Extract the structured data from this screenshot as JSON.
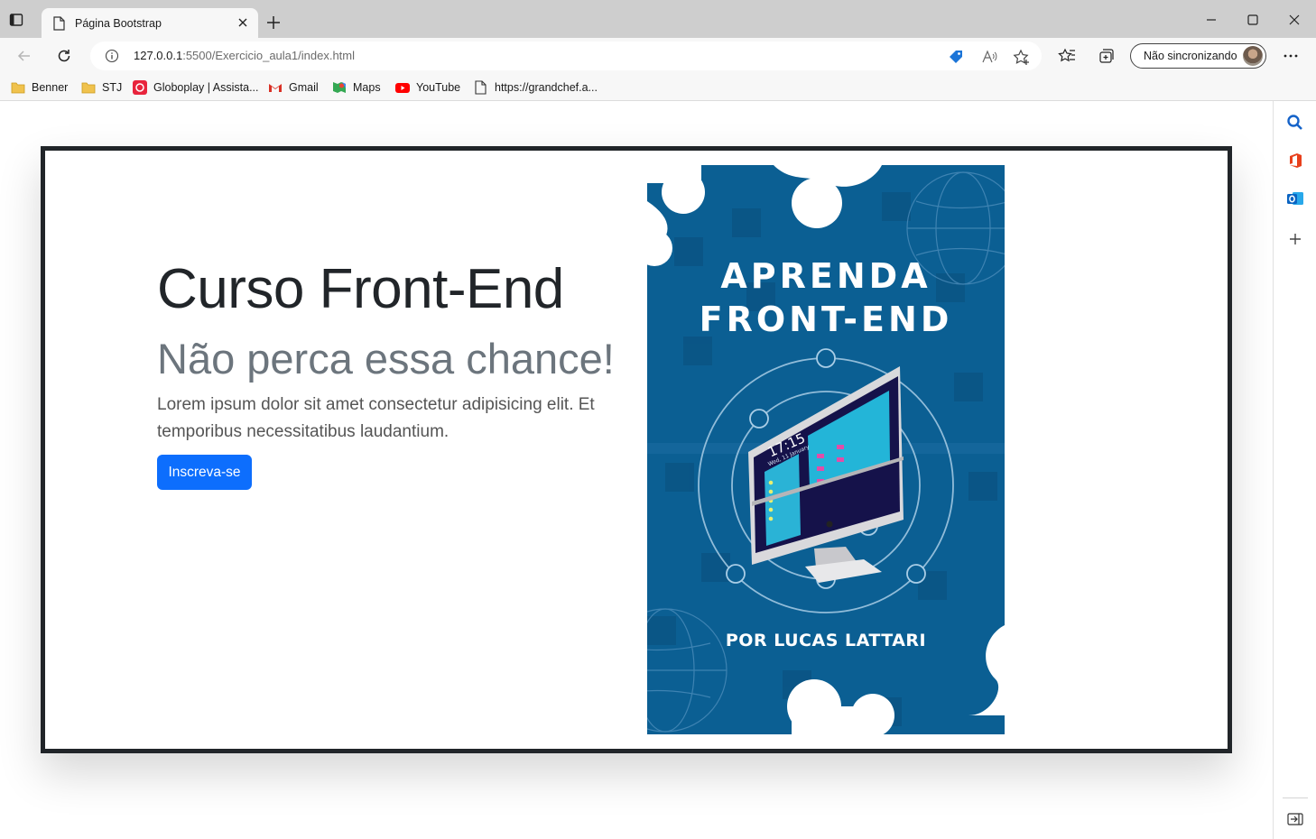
{
  "browser": {
    "tab_title": "Página Bootstrap",
    "url_host": "127.0.0.1",
    "url_path": ":5500/Exercicio_aula1/index.html",
    "sync_label": "Não sincronizando"
  },
  "bookmarks": [
    {
      "label": "Benner",
      "icon": "folder-icon"
    },
    {
      "label": "STJ",
      "icon": "folder-icon"
    },
    {
      "label": "Globoplay | Assista...",
      "icon": "globoplay-icon"
    },
    {
      "label": "Gmail",
      "icon": "gmail-icon"
    },
    {
      "label": "Maps",
      "icon": "maps-icon"
    },
    {
      "label": "YouTube",
      "icon": "youtube-icon"
    },
    {
      "label": "https://grandchef.a...",
      "icon": "page-icon"
    }
  ],
  "hero": {
    "title": "Curso Front-End",
    "subtitle": "Não perca essa chance!",
    "lead": "Lorem ipsum dolor sit amet consectetur adipisicing elit. Et temporibus necessitatibus laudantium.",
    "button_label": "Inscreva-se"
  },
  "poster": {
    "line1": "APRENDA",
    "line2": "FRONT-END",
    "byline": "POR LUCAS LATTARI",
    "clock_time": "17:15",
    "clock_date": "Wed, 11 January"
  },
  "colors": {
    "primary_button": "#0d6efd",
    "poster_bg": "#0b5f93",
    "hero_border": "#212529"
  }
}
